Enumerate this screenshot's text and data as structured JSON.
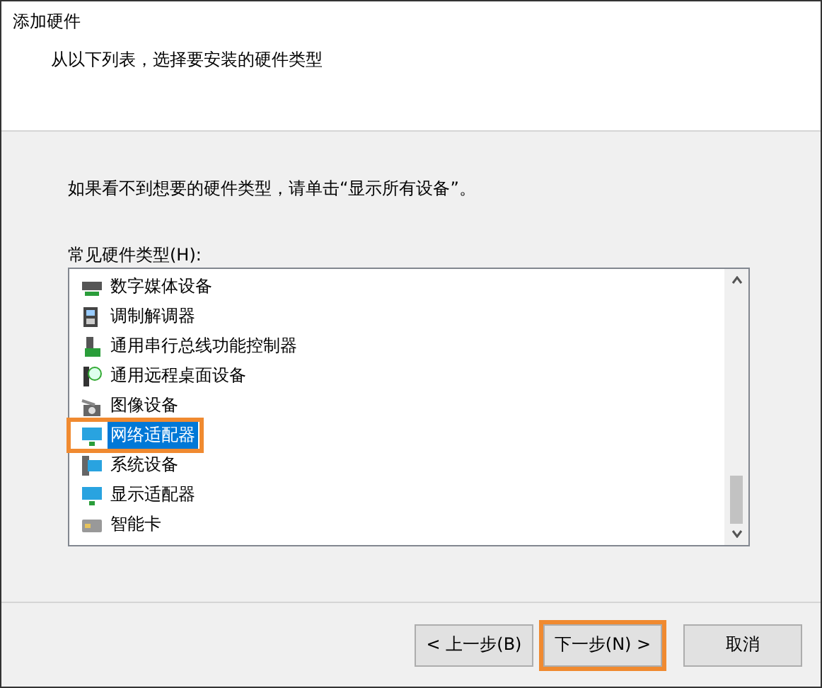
{
  "header": {
    "title": "添加硬件",
    "subtitle": "从以下列表，选择要安装的硬件类型"
  },
  "instruction": "如果看不到想要的硬件类型，请单击“显示所有设备”。",
  "list_label": "常见硬件类型(H):",
  "items": [
    {
      "label": "数字媒体设备",
      "kind": "media",
      "selected": false,
      "highlighted": false
    },
    {
      "label": "调制解调器",
      "kind": "modem",
      "selected": false,
      "highlighted": false
    },
    {
      "label": "通用串行总线功能控制器",
      "kind": "usb",
      "selected": false,
      "highlighted": false
    },
    {
      "label": "通用远程桌面设备",
      "kind": "remote",
      "selected": false,
      "highlighted": false
    },
    {
      "label": "图像设备",
      "kind": "camera",
      "selected": false,
      "highlighted": false
    },
    {
      "label": "网络适配器",
      "kind": "network",
      "selected": true,
      "highlighted": true
    },
    {
      "label": "系统设备",
      "kind": "system",
      "selected": false,
      "highlighted": false
    },
    {
      "label": "显示适配器",
      "kind": "display",
      "selected": false,
      "highlighted": false
    },
    {
      "label": "智能卡",
      "kind": "card",
      "selected": false,
      "highlighted": false
    }
  ],
  "buttons": [
    {
      "label": "< 上一步(B)",
      "highlighted": false
    },
    {
      "label": "下一步(N) >",
      "highlighted": true
    },
    {
      "label": "取消",
      "highlighted": false
    }
  ]
}
